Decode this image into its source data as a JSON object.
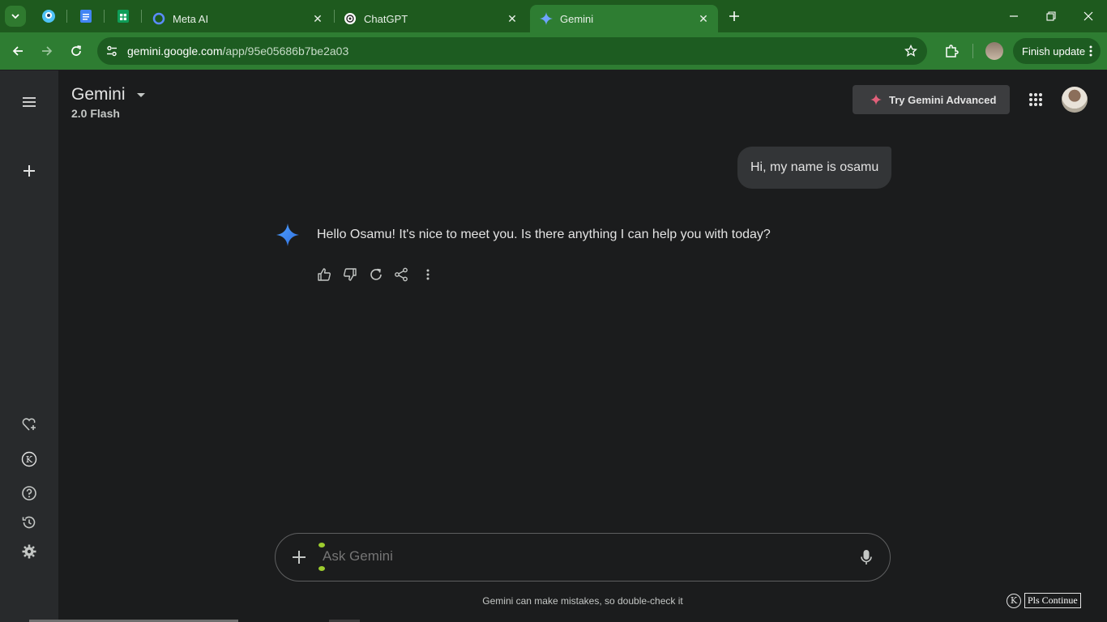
{
  "browser": {
    "tabs": [
      {
        "title": "Meta AI",
        "icon": "meta-ai-ring-icon"
      },
      {
        "title": "ChatGPT",
        "icon": "chatgpt-icon"
      },
      {
        "title": "Gemini",
        "icon": "gemini-spark-icon",
        "active": true
      }
    ],
    "pinned_tabs": [
      "pinned-site-icon",
      "google-docs-icon",
      "google-sheets-icon"
    ],
    "url_host": "gemini.google.com",
    "url_path": "/app/95e05686b7be2a03",
    "finish_update_label": "Finish update",
    "colors": {
      "frame": "#1e5a1e",
      "toolbar": "#2e7d32"
    }
  },
  "app": {
    "title": "Gemini",
    "model": "2.0 Flash",
    "try_advanced_label": "Try Gemini Advanced",
    "sidebar_icons": [
      "menu-icon",
      "new-chat-icon",
      "gem-manager-icon",
      "k-extension-icon",
      "help-icon",
      "activity-icon",
      "settings-icon"
    ]
  },
  "chat": {
    "user_message": "Hi, my name is osamu",
    "model_response": "Hello Osamu! It's nice to meet you. Is there anything I can help you with today?",
    "actions": [
      "thumb-up-icon",
      "thumb-down-icon",
      "regenerate-icon",
      "share-icon",
      "more-options-icon"
    ]
  },
  "composer": {
    "placeholder": "Ask Gemini"
  },
  "disclaimer": "Gemini can make mistakes, so double-check it",
  "extension_overlay": {
    "icon_letter": "K",
    "button_label": "Pls Continue"
  }
}
